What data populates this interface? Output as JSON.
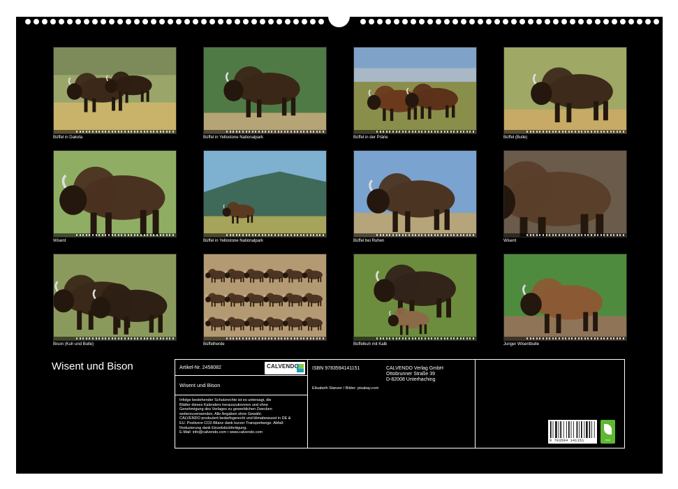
{
  "calendar": {
    "title": "Wisent und Bison",
    "images": [
      {
        "caption": "Büffel in Dakota",
        "scene": "dakota-herd"
      },
      {
        "caption": "Büffel in Yellostone Nationalpark",
        "scene": "forest-bull"
      },
      {
        "caption": "Büffel in der Prärie",
        "scene": "prairie-pair"
      },
      {
        "caption": "Büffel (Bulle)",
        "scene": "bull-front"
      },
      {
        "caption": "Wisent",
        "scene": "wisent-side"
      },
      {
        "caption": "Büffel in Yellostone Nationalpark",
        "scene": "mountain-bison"
      },
      {
        "caption": "Büffel bei Ruhen",
        "scene": "resting"
      },
      {
        "caption": "Wisent",
        "scene": "wisent-closeup"
      },
      {
        "caption": "Bison (Kuh und Bulle)",
        "scene": "cow-bull"
      },
      {
        "caption": "Büffelherde",
        "scene": "herd-dust"
      },
      {
        "caption": "Büffelkuh mit Kalb",
        "scene": "cow-calf"
      },
      {
        "caption": "Junger Wisentbulle",
        "scene": "young-bull"
      }
    ]
  },
  "info": {
    "article_label": "Artikel-Nr. 2458082",
    "logo_name": "CALVENDO",
    "product_title": "Wisent und Bison",
    "isbn": "ISBN 9783594141151",
    "publisher_lines": [
      "CALVENDO Verlag GmbH",
      "Ottobrunner Straße 39",
      "D-82008 Unterhaching"
    ],
    "credits": "Elisabeth Stanzer / Bilder: pixabay.com",
    "legal_lines": [
      "Infolge bestehender Schutzrechte ist es untersagt, die",
      "Blätter dieses Kalenders herauszutrennen und ohne",
      "Genehmigung des Verlages zu gewerblichen Zwecken",
      "weiterzuverwenden. Alle Angaben ohne Gewähr.",
      "CALVENDO produziert bedarfsgerecht und klimabewusst in DE &",
      "EU. Postivere CO2-Bilanz dank kurzer Transportwege. Abfall-",
      "Reduzierung dank Einzelstückfertigung.",
      "E-Mail: info@calvendo.com • www.calvendo.com"
    ],
    "barcode_number": "9 783594 141151",
    "eco_label": "eco"
  },
  "colors": {
    "background": "#000000",
    "accent_blue": "#1b9fc6",
    "accent_green": "#5fb832"
  }
}
